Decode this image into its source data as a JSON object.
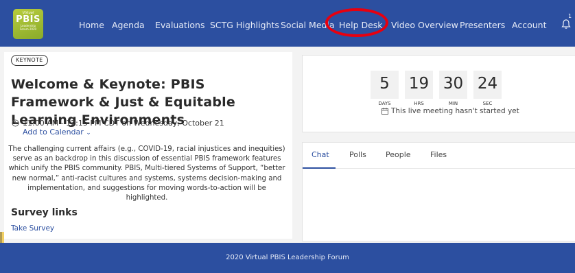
{
  "logo": {
    "line1": "Virtual",
    "line2": "PBIS",
    "line3": "Leadership",
    "line4": "Forum 2020"
  },
  "nav": {
    "items": [
      {
        "label": "Home"
      },
      {
        "label": "Agenda"
      },
      {
        "label": "Evaluations"
      },
      {
        "label": "SCTG Highlights"
      },
      {
        "label": "Social Media"
      },
      {
        "label": "Help Desk"
      },
      {
        "label": "Video Overview"
      },
      {
        "label": "Presenters"
      },
      {
        "label": "Account"
      }
    ],
    "notification_count": "1",
    "icons": {
      "notifications": "bell-icon"
    }
  },
  "session": {
    "badge": "KEYNOTE",
    "title": "Welcome & Keynote: PBIS Framework & Just & Equitable Learning Environments",
    "time": "11:00 AM - 12:15 PM CDT on Wednesday, October 21",
    "add_to_calendar": "Add to Calendar",
    "description": "The challenging current affairs (e.g., COVID-19, racial injustices and inequities) serve as an backdrop in this discussion of essential PBIS framework features which unify the PBIS community.  PBIS, Multi-tiered Systems of Support, “better new normal,” anti-racist cultures and systems, systems decision-making and implementation, and suggestions for moving words-to-action will be highlighted.",
    "survey_heading": "Survey links",
    "survey_link": "Take Survey"
  },
  "countdown": {
    "units": [
      {
        "value": "5",
        "label": "DAYS"
      },
      {
        "value": "19",
        "label": "HRS"
      },
      {
        "value": "30",
        "label": "MIN"
      },
      {
        "value": "24",
        "label": "SEC"
      }
    ],
    "status": "This live meeting hasn't started yet"
  },
  "tabs": [
    {
      "label": "Chat",
      "active": true
    },
    {
      "label": "Polls"
    },
    {
      "label": "People"
    },
    {
      "label": "Files"
    }
  ],
  "footer": {
    "text": "2020 Virtual PBIS Leadership Forum"
  },
  "colors": {
    "brand": "#2c4fa0",
    "highlight": "#e8000e",
    "logo_green": "#a4bd33"
  }
}
